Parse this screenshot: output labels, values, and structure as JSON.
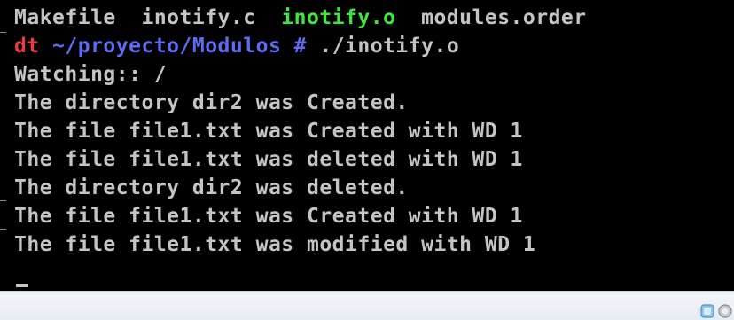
{
  "terminal": {
    "lines": [
      {
        "segments": [
          {
            "text": "Makefile  inotify.c  ",
            "color": "plain"
          },
          {
            "text": "inotify.o",
            "color": "green"
          },
          {
            "text": "  modules.order",
            "color": "plain"
          }
        ]
      },
      {
        "segments": [
          {
            "text": "dt ",
            "color": "red"
          },
          {
            "text": "~/proyecto/Modulos #",
            "color": "blue"
          },
          {
            "text": " ./inotify.o",
            "color": "plain"
          }
        ]
      },
      {
        "segments": [
          {
            "text": "Watching:: /",
            "color": "plain"
          }
        ]
      },
      {
        "segments": [
          {
            "text": "The directory dir2 was Created.",
            "color": "plain"
          }
        ]
      },
      {
        "segments": [
          {
            "text": "The file file1.txt was Created with WD 1",
            "color": "plain"
          }
        ]
      },
      {
        "segments": [
          {
            "text": "The file file1.txt was deleted with WD 1",
            "color": "plain"
          }
        ]
      },
      {
        "segments": [
          {
            "text": "The directory dir2 was deleted.",
            "color": "plain"
          }
        ]
      },
      {
        "segments": [
          {
            "text": "The file file1.txt was Created with WD 1",
            "color": "plain"
          }
        ]
      },
      {
        "segments": [
          {
            "text": "The file file1.txt was modified with WD 1",
            "color": "plain"
          }
        ]
      }
    ]
  },
  "colors": {
    "background": "#000000",
    "text": "#c4c4c4",
    "green": "#3ee63e",
    "red": "#e63e3e",
    "blue": "#5e6cf2"
  },
  "tray": {
    "icons": [
      "network-icon",
      "power-icon"
    ]
  }
}
